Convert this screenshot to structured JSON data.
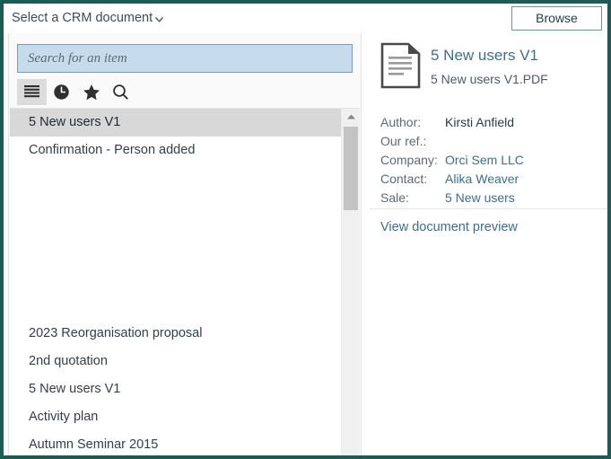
{
  "window": {
    "accent_border_color": "#1c5c55"
  },
  "topbar": {
    "crm_select_label": "Select a CRM document",
    "chevron_icon": "chevron-down-icon",
    "browse_label": "Browse"
  },
  "search": {
    "placeholder": "Search for an item",
    "value": ""
  },
  "view_toolbar": {
    "items": [
      {
        "name": "list-view",
        "icon": "list-icon",
        "active": true
      },
      {
        "name": "recent-view",
        "icon": "clock-icon",
        "active": false
      },
      {
        "name": "favourites-view",
        "icon": "star-icon",
        "active": false
      },
      {
        "name": "search-view",
        "icon": "search-icon",
        "active": false
      }
    ]
  },
  "document_list": {
    "group_one": [
      {
        "label": "5 New users V1",
        "selected": true
      },
      {
        "label": "Confirmation - Person added",
        "selected": false
      }
    ],
    "group_two": [
      {
        "label": "2023 Reorganisation proposal",
        "selected": false
      },
      {
        "label": "2nd quotation",
        "selected": false
      },
      {
        "label": "5 New users V1",
        "selected": false
      },
      {
        "label": "Activity plan",
        "selected": false
      },
      {
        "label": "Autumn Seminar 2015",
        "selected": false
      }
    ],
    "scrollbar": {
      "up_arrow_icon": "caret-up-icon"
    }
  },
  "details": {
    "doc_icon": "document-icon",
    "title": "5 New users V1",
    "filename": "5 New users V1.PDF",
    "fields": [
      {
        "label": "Author:",
        "value": "Kirsti Anfield",
        "is_link": false
      },
      {
        "label": "Our ref.:",
        "value": "",
        "is_link": false
      },
      {
        "label": "Company:",
        "value": "Orci Sem LLC",
        "is_link": true
      },
      {
        "label": "Contact:",
        "value": "Alika Weaver",
        "is_link": true
      },
      {
        "label": "Sale:",
        "value": "5 New users",
        "is_link": true
      }
    ],
    "preview_link_label": "View document preview"
  },
  "colors": {
    "accent_teal": "#1c5c55",
    "search_field_bg": "#c6dcec",
    "selected_row_bg": "#d8d8d8",
    "link_blue": "#3f6e8c"
  }
}
